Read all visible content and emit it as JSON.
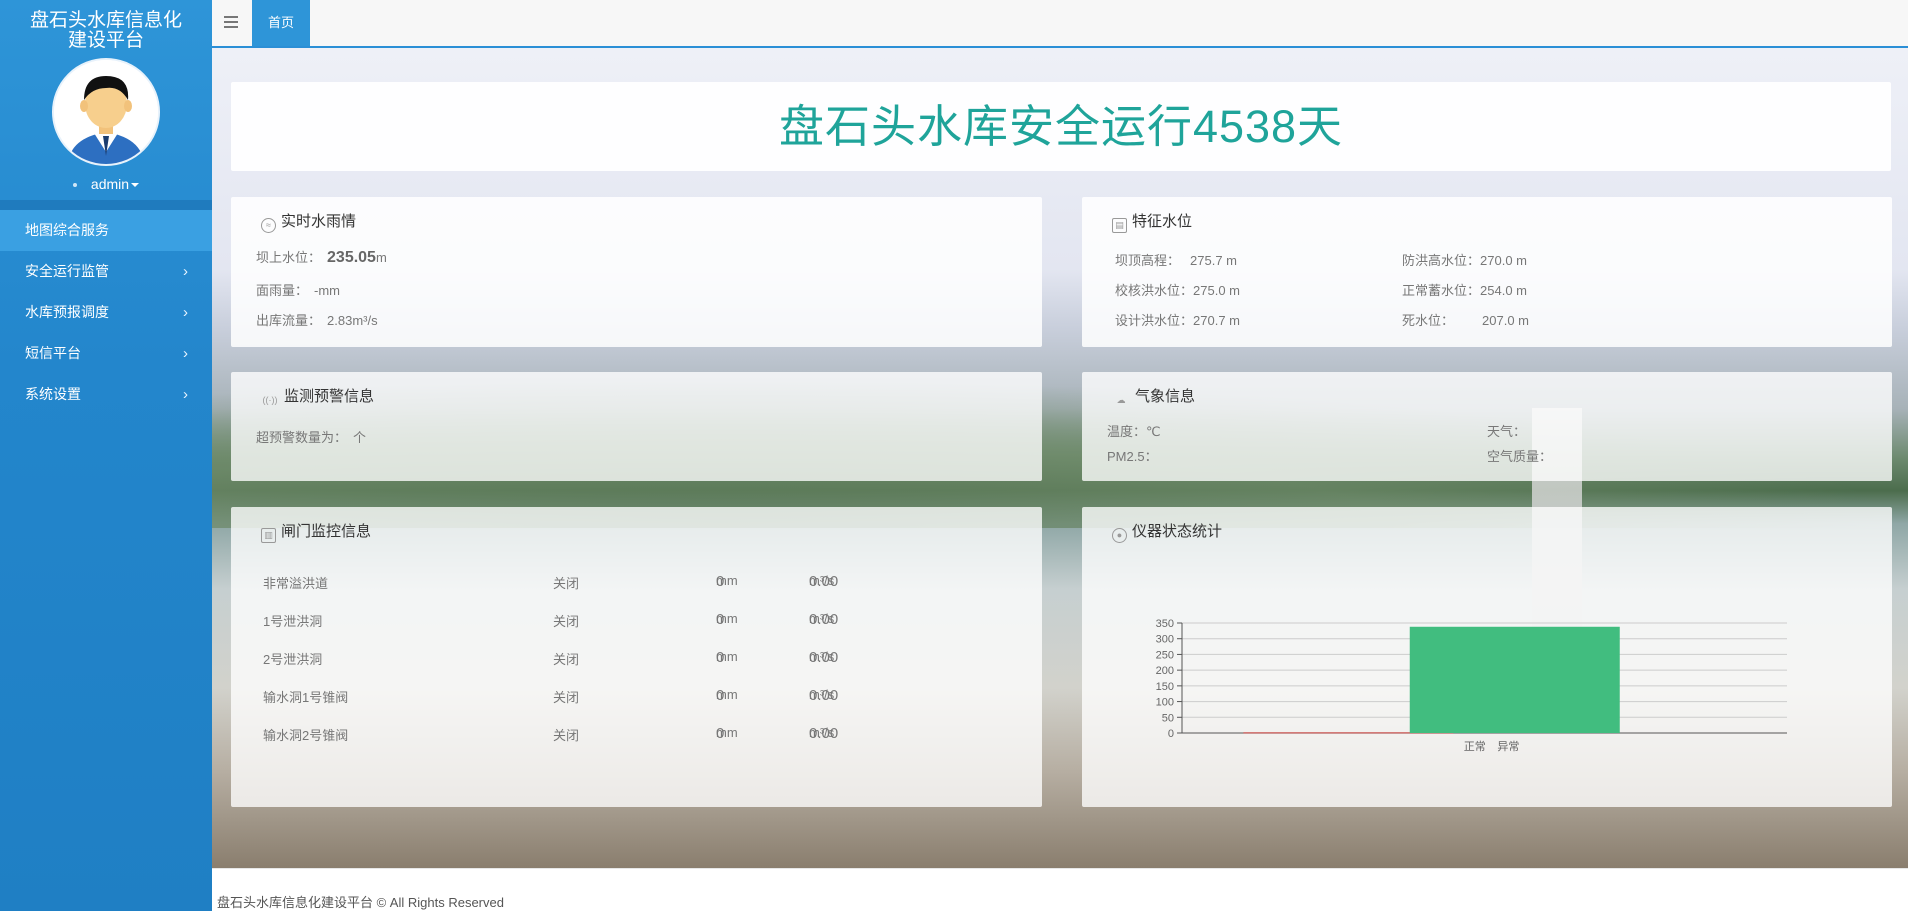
{
  "app": {
    "title_line1": "盘石头水库信息化",
    "title_line2": "建设平台",
    "user": "admin"
  },
  "sidebar": {
    "items": [
      {
        "label": "地图综合服务",
        "has_submenu": false
      },
      {
        "label": "安全运行监管",
        "has_submenu": true
      },
      {
        "label": "水库预报调度",
        "has_submenu": true
      },
      {
        "label": "短信平台",
        "has_submenu": true
      },
      {
        "label": "系统设置",
        "has_submenu": true
      }
    ],
    "chevron": "›"
  },
  "tabs": {
    "home": "首页"
  },
  "hero": {
    "title": "盘石头水库安全运行4538天"
  },
  "rain": {
    "title": "实时水雨情",
    "dam_level_label": "坝上水位：",
    "dam_level_value": "235.05",
    "dam_level_unit": "m",
    "rainfall_label": "面雨量：",
    "rainfall_value": "-mm",
    "outflow_label": "出库流量：",
    "outflow_value": "2.83m³/s"
  },
  "level": {
    "title": "特征水位",
    "crest_label": "坝顶高程：",
    "crest_value": "275.7 m",
    "check_flood_label": "校核洪水位：",
    "check_flood_value": "275.0 m",
    "design_flood_label": "设计洪水位：",
    "design_flood_value": "270.7 m",
    "flood_high_label": "防洪高水位：",
    "flood_high_value": "270.0 m",
    "normal_label": "正常蓄水位：",
    "normal_value": "254.0 m",
    "dead_label": "死水位：",
    "dead_value": "207.0 m"
  },
  "warn": {
    "title": "监测预警信息",
    "count_label": "超预警数量为：",
    "count_unit": "个"
  },
  "weather": {
    "title": "气象信息",
    "temp_label": "温度：",
    "temp_unit": "℃",
    "pm_label": "PM2.5：",
    "weather_label": "天气：",
    "air_label": "空气质量："
  },
  "gate": {
    "title": "闸门监控信息",
    "rows": [
      {
        "name": "非常溢洪道",
        "status": "关闭",
        "opening": "0",
        "opening_unit": "mm",
        "flow": "0.00",
        "flow_unit": "m³/s"
      },
      {
        "name": "1号泄洪洞",
        "status": "关闭",
        "opening": "0",
        "opening_unit": "mm",
        "flow": "0.00",
        "flow_unit": "m³/s"
      },
      {
        "name": "2号泄洪洞",
        "status": "关闭",
        "opening": "0",
        "opening_unit": "mm",
        "flow": "0.00",
        "flow_unit": "m³/s"
      },
      {
        "name": "输水洞1号锥阀",
        "status": "关闭",
        "opening": "0",
        "opening_unit": "mm",
        "flow": "0.00",
        "flow_unit": "m³/s"
      },
      {
        "name": "输水洞2号锥阀",
        "status": "关闭",
        "opening": "0",
        "opening_unit": "mm",
        "flow": "0.00",
        "flow_unit": "m³/s"
      }
    ]
  },
  "instr": {
    "title": "仪器状态统计"
  },
  "chart_data": {
    "type": "bar",
    "categories": [
      "异常",
      "正常"
    ],
    "values": [
      2,
      338
    ],
    "colors": [
      "#c23531",
      "#41bd7f"
    ],
    "title": "",
    "xlabel": "",
    "ylabel": "",
    "ylim": [
      0,
      350
    ],
    "yticks": [
      0,
      50,
      100,
      150,
      200,
      250,
      300,
      350
    ],
    "grid": true
  },
  "footer": {
    "text": "盘石头水库信息化建设平台 © All Rights Reserved"
  }
}
